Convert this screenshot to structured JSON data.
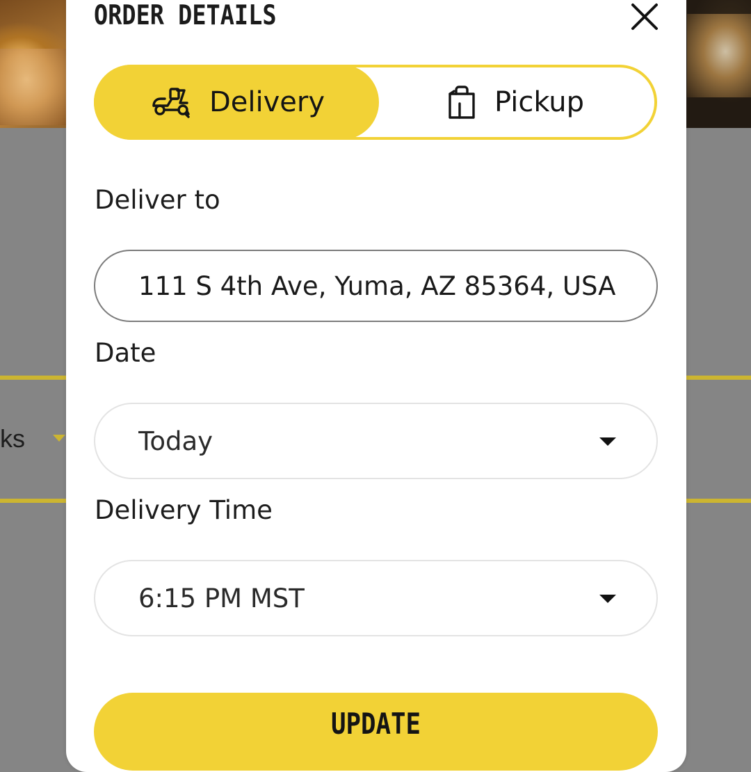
{
  "background": {
    "partial_label": "ks"
  },
  "modal": {
    "title": "ORDER DETAILS",
    "close_icon": "close-icon"
  },
  "mode_toggle": {
    "selected": "Delivery",
    "options": [
      {
        "label": "Delivery",
        "icon": "scooter-icon"
      },
      {
        "label": "Pickup",
        "icon": "shopping-bag-icon"
      }
    ]
  },
  "form": {
    "address": {
      "label": "Deliver to",
      "value": "111 S 4th Ave, Yuma, AZ 85364, USA"
    },
    "date": {
      "label": "Date",
      "value": "Today"
    },
    "time": {
      "label": "Delivery Time",
      "value": "6:15 PM MST"
    }
  },
  "actions": {
    "update_label": "UPDATE"
  },
  "colors": {
    "accent": "#f2d236",
    "overlay": "#858585",
    "text": "#1a1a1a"
  }
}
